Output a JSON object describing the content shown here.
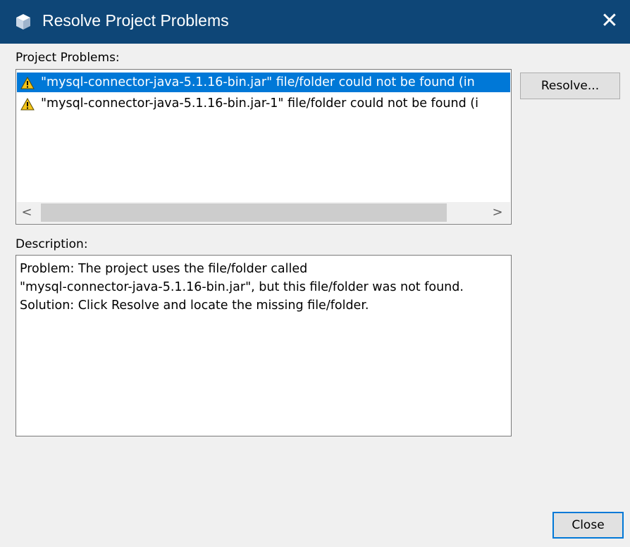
{
  "window": {
    "title": "Resolve Project Problems",
    "app_icon": "netbeans-cube-icon",
    "close_glyph": "✕",
    "titlebar_color": "#0e4677"
  },
  "problems": {
    "label": "Project Problems:",
    "items": [
      {
        "icon": "warning-icon",
        "text": "\"mysql-connector-java-5.1.16-bin.jar\" file/folder could not be found (in",
        "selected": true
      },
      {
        "icon": "warning-icon",
        "text": "\"mysql-connector-java-5.1.16-bin.jar-1\" file/folder could not be found (i",
        "selected": false
      }
    ],
    "scroll_left": "<",
    "scroll_right": ">"
  },
  "buttons": {
    "resolve": "Resolve...",
    "close": "Close"
  },
  "description": {
    "label": "Description:",
    "lines": [
      "Problem: The project uses the file/folder called",
      "\"mysql-connector-java-5.1.16-bin.jar\", but this file/folder was not found.",
      "Solution: Click Resolve and locate the missing file/folder."
    ]
  },
  "colors": {
    "selection": "#0078d7",
    "window_bg": "#f0f0f0"
  }
}
